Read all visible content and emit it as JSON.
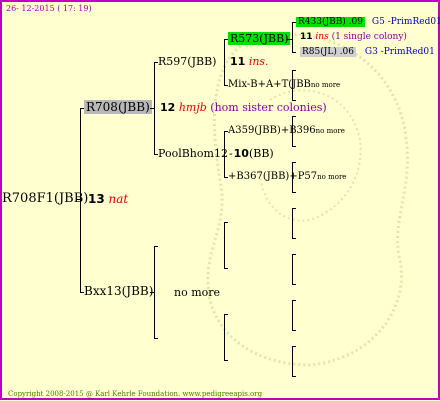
{
  "header": {
    "date": "26- 12-2015 ( 17: 19)"
  },
  "footer": {
    "copyright": "Copyright 2008-2015 @ Karl Kehrle Foundation.   www.pedigreeapis.org"
  },
  "root": {
    "label": "R708F1(JBB)",
    "num": "13",
    "tag": "nat"
  },
  "dam": {
    "label": "R708(JBB)",
    "num": "12",
    "tag": "hmjb",
    "note": "(hom sister colonies)"
  },
  "dam_dam": {
    "label": "R597(JBB)",
    "num": "11",
    "tag": "ins."
  },
  "ddd": {
    "label": "R573(JBB)"
  },
  "dddd": {
    "label": "R433(JBB) .09",
    "extra": "G5 -PrimRed01"
  },
  "dddd_num": {
    "num": "11",
    "tag": "ins",
    "note": "(1 single colony)"
  },
  "dddf": {
    "label": "R85(JL) .06",
    "extra": "G3 -PrimRed01"
  },
  "dd_sire": {
    "label": "Mix-B+A+T(JBB",
    "suffix": "no more"
  },
  "dam_sire": {
    "label": "PoolBhom12",
    "num": "10",
    "suffix": "(BB)"
  },
  "dsd": {
    "label": "A359(JBB)+B396",
    "suffix": "no more"
  },
  "dss": {
    "label": "+B367(JBB)+P57",
    "suffix": "no more"
  },
  "sire": {
    "label": "Bxx13(JBB)",
    "note": "no more"
  }
}
